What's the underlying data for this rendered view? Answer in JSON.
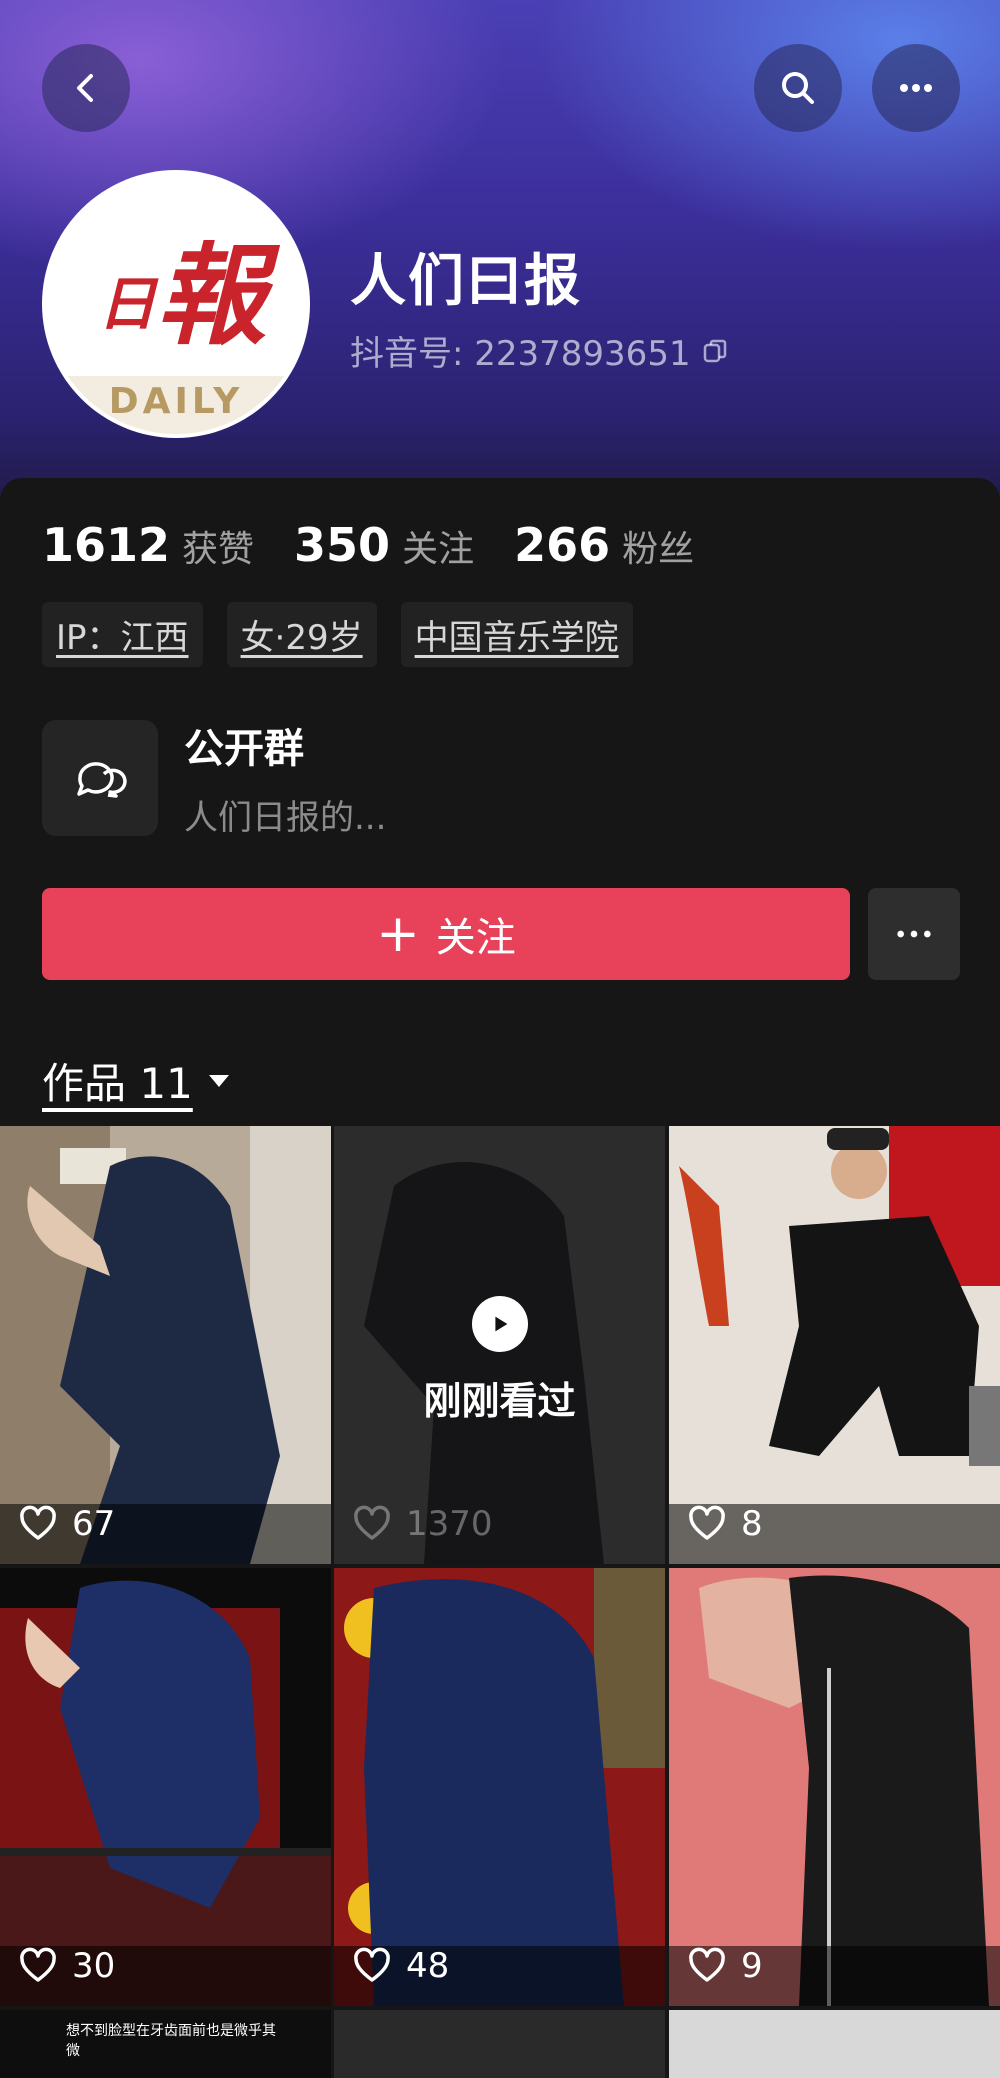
{
  "nav": {
    "back_icon": "chevron-left-icon",
    "search_icon": "search-icon",
    "more_icon": "more-dots-icon"
  },
  "profile": {
    "avatar_glyphs": "日 報",
    "avatar_subtitle": "DAILY",
    "name": "人们曰报",
    "uid_label": "抖音号: 2237893651"
  },
  "stats": [
    {
      "value": "1612",
      "label": "获赞"
    },
    {
      "value": "350",
      "label": "关注"
    },
    {
      "value": "266",
      "label": "粉丝"
    }
  ],
  "tags": [
    "IP：江西",
    "女·29岁",
    "中国音乐学院"
  ],
  "group": {
    "title": "公开群",
    "subtitle": "人们日报的..."
  },
  "follow_button": {
    "label": "关注"
  },
  "works": {
    "label": "作品 11"
  },
  "videos": [
    {
      "likes": "67",
      "watched": false
    },
    {
      "likes": "1370",
      "watched": true,
      "watched_label": "刚刚看过"
    },
    {
      "likes": "8",
      "watched": false
    },
    {
      "likes": "30",
      "watched": false
    },
    {
      "likes": "48",
      "watched": false
    },
    {
      "likes": "9",
      "watched": false
    }
  ],
  "partial_caption": "想不到脸型在牙齿面前也是微乎其微",
  "colors": {
    "accent": "#e8415a",
    "panel": "#161616",
    "header": "#3c2f9c"
  }
}
